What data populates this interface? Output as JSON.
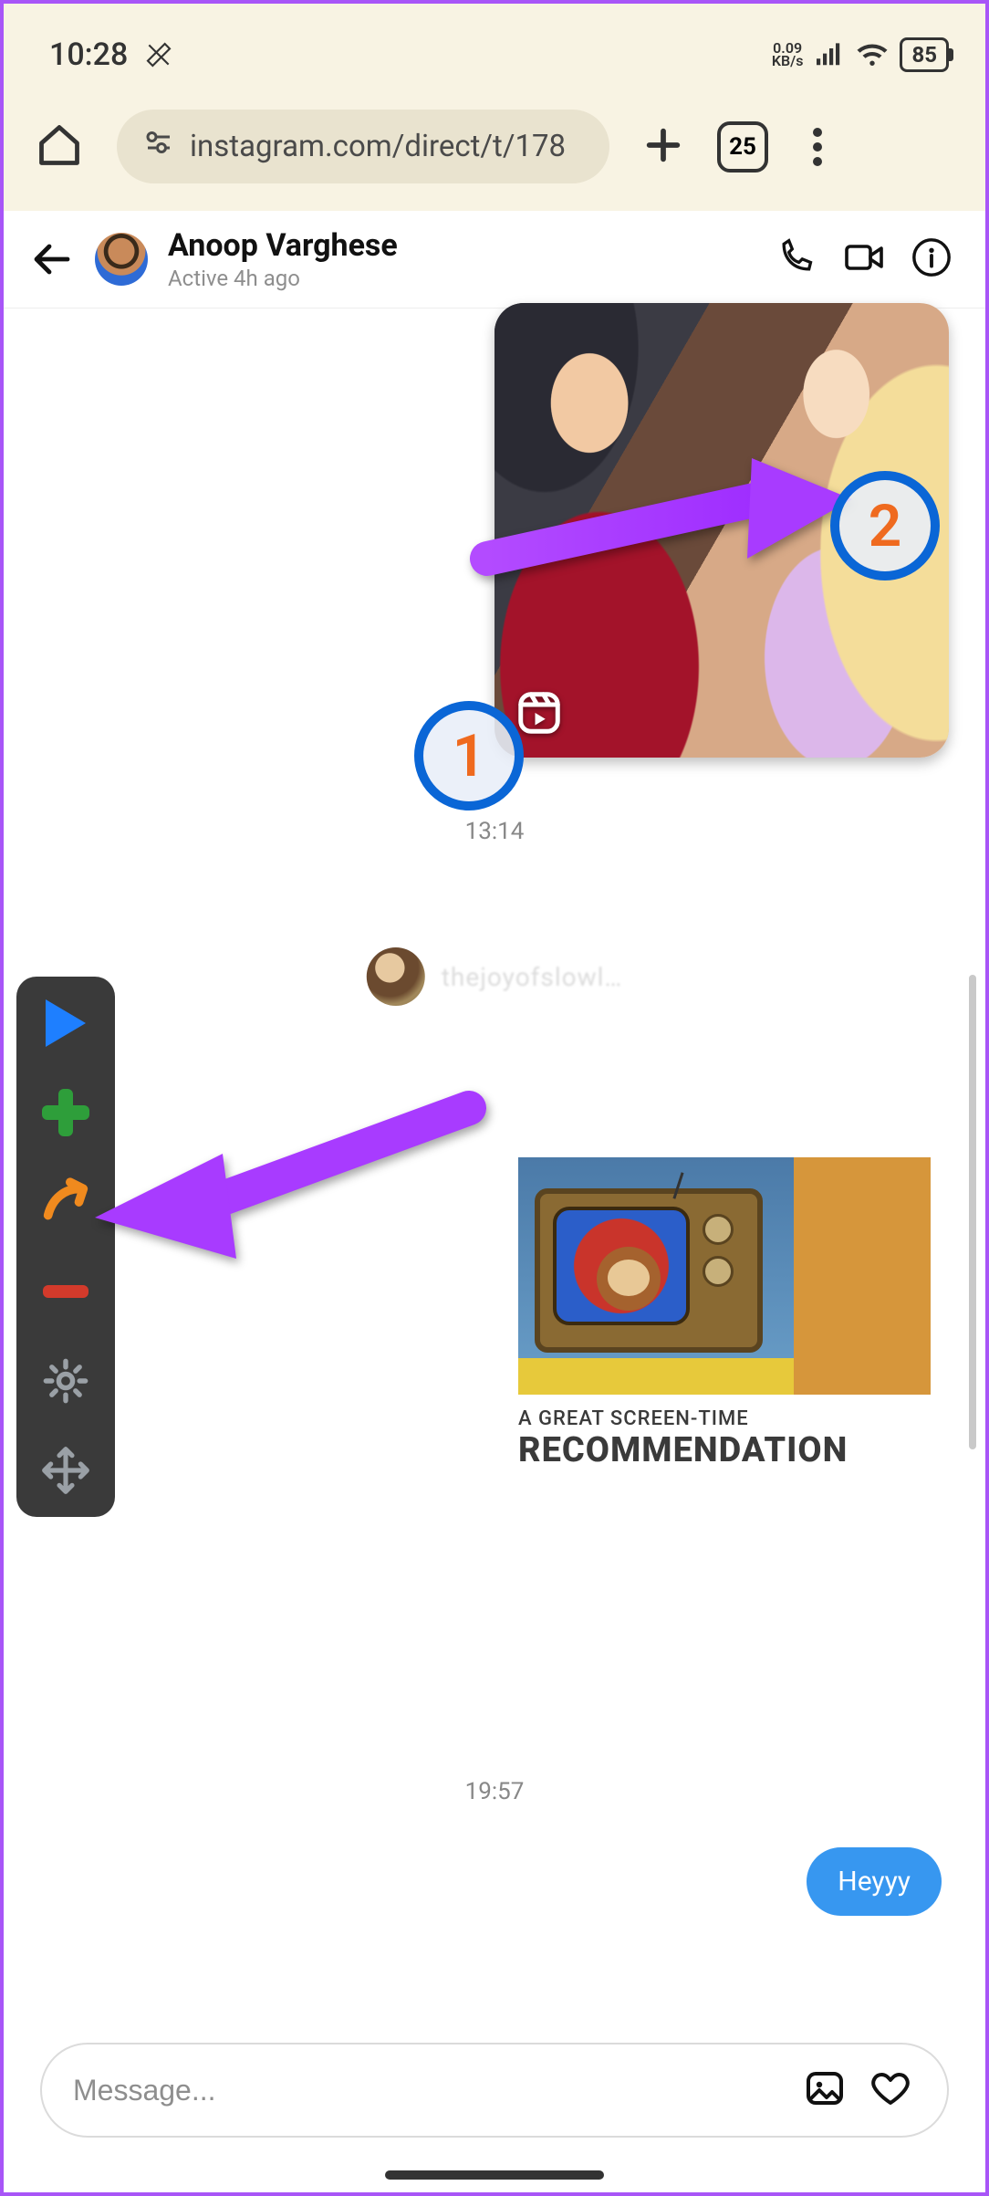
{
  "status_bar": {
    "time": "10:28",
    "data_rate_top": "0.09",
    "data_rate_bottom": "KB/s",
    "battery_percent": "85"
  },
  "browser": {
    "url": "instagram.com/direct/t/178",
    "tab_count": "25"
  },
  "chat_header": {
    "name": "Anoop Varghese",
    "status": "Active 4h ago"
  },
  "timestamps": {
    "t1": "13:14",
    "t2": "19:57"
  },
  "shared_profile": {
    "name": "thejoyofslowl…"
  },
  "recommendation": {
    "line1": "A GREAT SCREEN-TIME",
    "line2": "RECOMMENDATION"
  },
  "sent_message": "Heyyy",
  "composer": {
    "placeholder": "Message..."
  },
  "annotations": {
    "marker1": "1",
    "marker2": "2"
  }
}
